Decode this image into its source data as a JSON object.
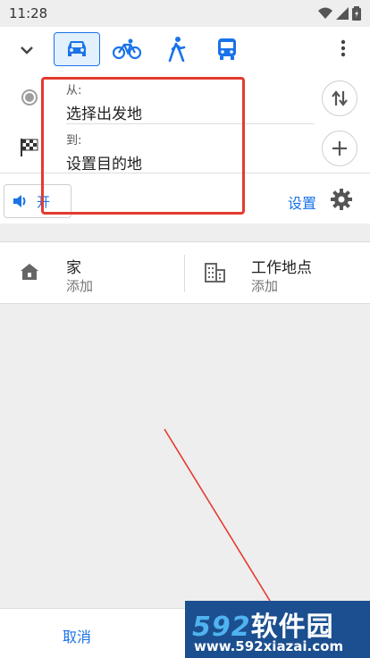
{
  "status_bar": {
    "time": "11:28"
  },
  "route": {
    "from_label": "从:",
    "from_value": "选择出发地",
    "to_label": "到:",
    "to_value": "设置目的地"
  },
  "travel_modes": [
    "car",
    "bike",
    "walk",
    "bus"
  ],
  "active_mode": "car",
  "voice": {
    "label": "开"
  },
  "settings": {
    "label": "设置"
  },
  "places": [
    {
      "title": "家",
      "subtitle": "添加",
      "icon": "home-icon"
    },
    {
      "title": "工作地点",
      "subtitle": "添加",
      "icon": "work-building-icon"
    }
  ],
  "bottom": {
    "cancel_label": "取消"
  },
  "watermark": {
    "top_num": "592",
    "top_text": "软件园",
    "bottom": "www.592xiazai.com"
  },
  "colors": {
    "accent": "#1a73e8",
    "highlight": "#e33b2e",
    "watermark_bg": "#1b4f8f"
  }
}
